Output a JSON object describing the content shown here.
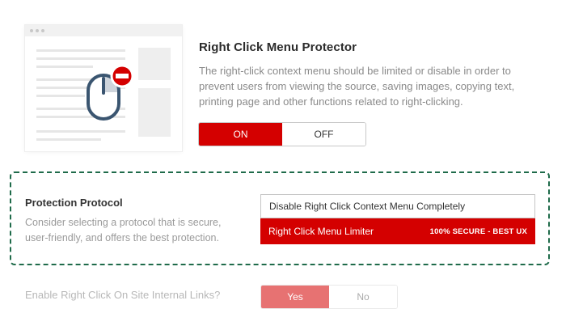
{
  "feature": {
    "title": "Right Click Menu Protector",
    "description": "The right-click context menu should be limited or disable in order to prevent users from viewing the source, saving images, copying text, printing page and other functions related to right-clicking.",
    "toggle": {
      "on_label": "ON",
      "off_label": "OFF",
      "selected": "ON"
    }
  },
  "protocol": {
    "title": "Protection Protocol",
    "description": "Consider selecting a protocol that is secure, user-friendly, and offers the best protection.",
    "select": {
      "current_value": "Disable Right Click Context Menu Completely",
      "highlighted_option": {
        "label": "Right Click Menu Limiter",
        "badge": "100% SECURE - BEST UX"
      }
    }
  },
  "internal_links": {
    "label": "Enable Right Click On Site Internal Links?",
    "yes_label": "Yes",
    "no_label": "No",
    "selected": "Yes"
  },
  "colors": {
    "accent": "#d40000",
    "dashed_border": "#1f6b4a",
    "muted_text": "#8a8a8a"
  },
  "icons": {
    "illustration": "mouse-blocked-illustration",
    "block_badge": "no-entry-icon",
    "mouse": "mouse-icon"
  }
}
